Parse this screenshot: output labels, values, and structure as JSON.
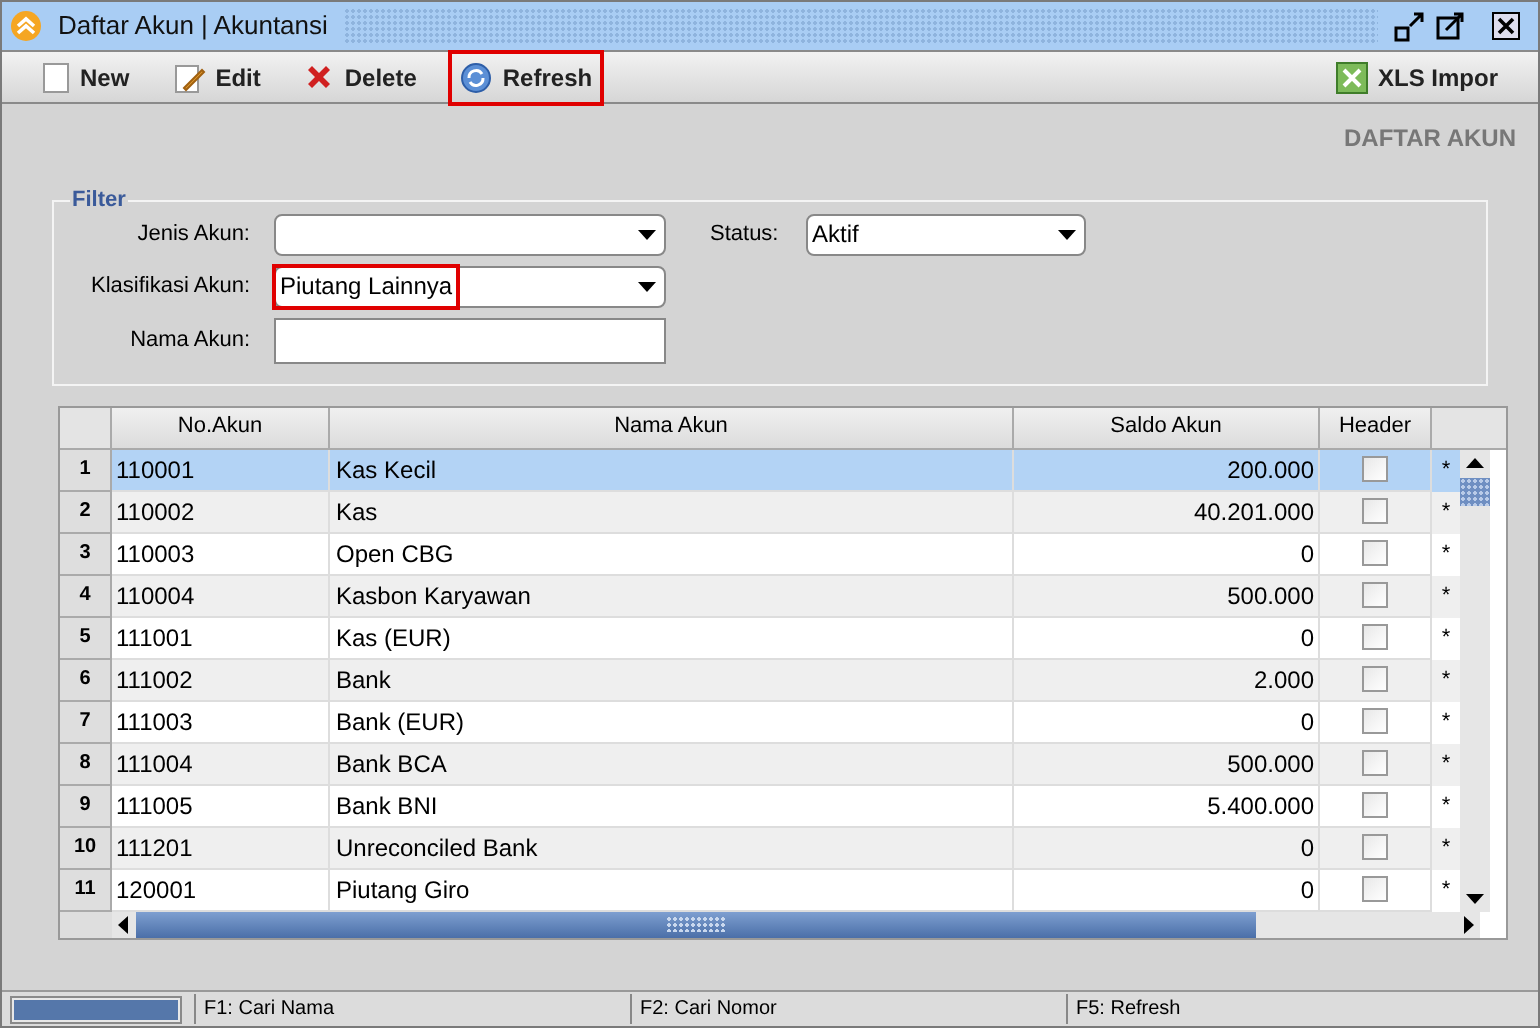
{
  "window": {
    "title": "Daftar Akun | Akuntansi"
  },
  "toolbar": [
    {
      "kind": "new",
      "label": "New",
      "highlighted": false
    },
    {
      "kind": "edit",
      "label": "Edit",
      "highlighted": false
    },
    {
      "kind": "delete",
      "label": "Delete",
      "highlighted": false
    },
    {
      "kind": "refresh",
      "label": "Refresh",
      "highlighted": true
    }
  ],
  "toolbar_right": {
    "label": "XLS Impor"
  },
  "page_heading": "DAFTAR AKUN",
  "filter": {
    "title": "Filter",
    "jenis_akun": {
      "label": "Jenis Akun:"
    },
    "status": {
      "label": "Status:",
      "value": "Aktif",
      "highlighted": false
    },
    "klasifikasi_akun": {
      "label": "Klasifikasi Akun:",
      "value": "Piutang Lainnya",
      "highlighted": true
    },
    "nama_akun": {
      "label": "Nama Akun:"
    }
  },
  "table": {
    "columns": [
      "No.Akun",
      "Nama Akun",
      "Saldo Akun",
      "Header"
    ],
    "rows": [
      {
        "index": "1",
        "no": "110001",
        "name": "Kas Kecil",
        "saldo": "200.000",
        "header": false,
        "mark": "*",
        "selected": true
      },
      {
        "index": "2",
        "no": "110002",
        "name": "Kas",
        "saldo": "40.201.000",
        "header": false,
        "mark": "*",
        "selected": false
      },
      {
        "index": "3",
        "no": "110003",
        "name": "Open CBG",
        "saldo": "0",
        "header": false,
        "mark": "*",
        "selected": false
      },
      {
        "index": "4",
        "no": "110004",
        "name": "Kasbon Karyawan",
        "saldo": "500.000",
        "header": false,
        "mark": "*",
        "selected": false
      },
      {
        "index": "5",
        "no": "111001",
        "name": "Kas (EUR)",
        "saldo": "0",
        "header": false,
        "mark": "*",
        "selected": false
      },
      {
        "index": "6",
        "no": "111002",
        "name": "Bank",
        "saldo": "2.000",
        "header": false,
        "mark": "*",
        "selected": false
      },
      {
        "index": "7",
        "no": "111003",
        "name": "Bank (EUR)",
        "saldo": "0",
        "header": false,
        "mark": "*",
        "selected": false
      },
      {
        "index": "8",
        "no": "111004",
        "name": "Bank BCA",
        "saldo": "500.000",
        "header": false,
        "mark": "*",
        "selected": false
      },
      {
        "index": "9",
        "no": "111005",
        "name": "Bank BNI",
        "saldo": "5.400.000",
        "header": false,
        "mark": "*",
        "selected": false
      },
      {
        "index": "10",
        "no": "111201",
        "name": "Unreconciled Bank",
        "saldo": "0",
        "header": false,
        "mark": "*",
        "selected": false
      },
      {
        "index": "11",
        "no": "120001",
        "name": "Piutang Giro",
        "saldo": "0",
        "header": false,
        "mark": "*",
        "selected": false
      }
    ]
  },
  "progress": {
    "level": 1
  },
  "status_bar": [
    "F1: Cari Nama",
    "F2: Cari Nomor",
    "F5: Refresh"
  ]
}
